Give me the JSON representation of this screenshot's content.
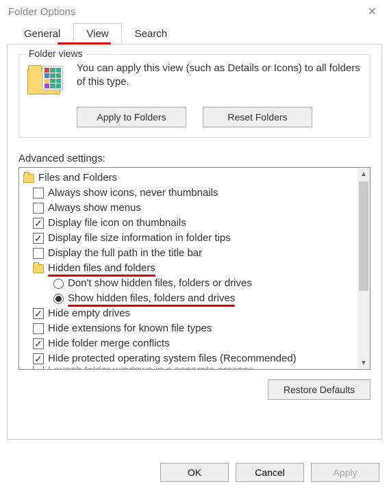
{
  "window": {
    "title": "Folder Options"
  },
  "tabs": {
    "general": "General",
    "view": "View",
    "search": "Search",
    "active": "view"
  },
  "folder_views": {
    "legend": "Folder views",
    "description": "You can apply this view (such as Details or Icons) to all folders of this type.",
    "apply_btn": "Apply to Folders",
    "reset_btn": "Reset Folders"
  },
  "advanced": {
    "label": "Advanced settings:",
    "root": "Files and Folders",
    "items": [
      {
        "type": "checkbox",
        "checked": false,
        "label": "Always show icons, never thumbnails"
      },
      {
        "type": "checkbox",
        "checked": false,
        "label": "Always show menus"
      },
      {
        "type": "checkbox",
        "checked": true,
        "label": "Display file icon on thumbnails"
      },
      {
        "type": "checkbox",
        "checked": true,
        "label": "Display file size information in folder tips"
      },
      {
        "type": "checkbox",
        "checked": false,
        "label": "Display the full path in the title bar"
      }
    ],
    "hidden_group": {
      "label": "Hidden files and folders",
      "options": [
        {
          "selected": false,
          "label": "Don't show hidden files, folders or drives"
        },
        {
          "selected": true,
          "label": "Show hidden files, folders and drives"
        }
      ]
    },
    "items_after": [
      {
        "type": "checkbox",
        "checked": true,
        "label": "Hide empty drives"
      },
      {
        "type": "checkbox",
        "checked": false,
        "label": "Hide extensions for known file types"
      },
      {
        "type": "checkbox",
        "checked": true,
        "label": "Hide folder merge conflicts"
      },
      {
        "type": "checkbox",
        "checked": true,
        "label": "Hide protected operating system files (Recommended)"
      },
      {
        "type": "checkbox",
        "checked": false,
        "label": "Launch folder windows in a separate process"
      }
    ],
    "restore_btn": "Restore Defaults"
  },
  "buttons": {
    "ok": "OK",
    "cancel": "Cancel",
    "apply": "Apply"
  }
}
